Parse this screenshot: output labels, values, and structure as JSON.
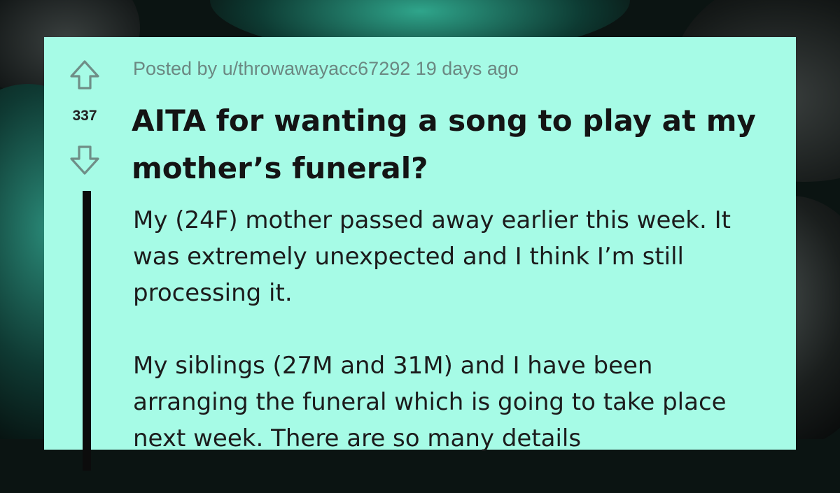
{
  "post": {
    "meta": "Posted by u/throwawayacc67292 19 days ago",
    "score": "337",
    "title": "AITA for wanting a song to play at my mother’s funeral?",
    "paragraphs": [
      "My (24F) mother passed away earlier this week. It was extremely unexpected and I think I’m still processing it.",
      "My siblings (27M and 31M) and I have been arranging the funeral which is going to take place next week. There are so many details"
    ]
  },
  "icons": {
    "upvote": "upvote-arrow-icon",
    "downvote": "downvote-arrow-icon"
  },
  "colors": {
    "card_background": "#a6fbe6",
    "text": "#141414",
    "meta_text": "#6b8882",
    "thread_bar": "#0c0c0c"
  }
}
